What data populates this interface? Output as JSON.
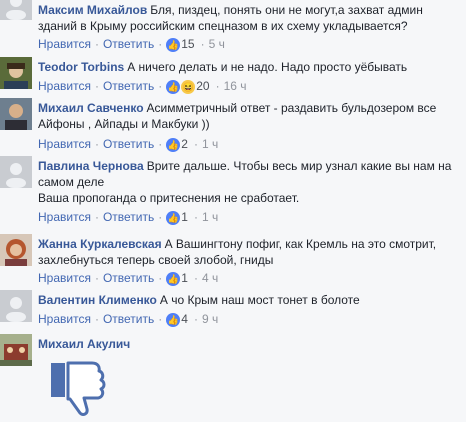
{
  "comments": [
    {
      "author": "Максим Михайлов",
      "text": "Бля, пиздец, понять они не могут,а захват админ зданий в Крыму российским спецназом в их схему укладывается?",
      "like_label": "Нравится",
      "reply_label": "Ответить",
      "reaction_count": "15",
      "time": "5 ч",
      "reactions": [
        "like"
      ]
    },
    {
      "author": "Teodor Torbins",
      "text": "А ничего делать и не надо. Надо просто уёбывать",
      "like_label": "Нравится",
      "reply_label": "Ответить",
      "reaction_count": "20",
      "time": "16 ч",
      "reactions": [
        "like",
        "haha"
      ]
    },
    {
      "author": "Михаил Савченко",
      "text": "Асимметричный ответ - раздавить бульдозером все Айфоны , Айпады и Макбуки ))",
      "like_label": "Нравится",
      "reply_label": "Ответить",
      "reaction_count": "2",
      "time": "1 ч",
      "reactions": [
        "like"
      ]
    },
    {
      "author": "Павлина Чернова",
      "text": "Врите дальше. Чтобы весь мир узнал какие вы нам на самом деле",
      "text2": "Ваша пропоганда о притеснения не сработает.",
      "like_label": "Нравится",
      "reply_label": "Ответить",
      "reaction_count": "1",
      "time": "1 ч",
      "reactions": [
        "like"
      ]
    },
    {
      "author": "Жанна Куркалевская",
      "text": "А Вашингтону пофиг, как Кремль на это смотрит, захлебнуться теперь своей злобой, гниды",
      "like_label": "Нравится",
      "reply_label": "Ответить",
      "reaction_count": "1",
      "time": "4 ч",
      "reactions": [
        "like"
      ]
    },
    {
      "author": "Валентин Клименко",
      "text": "А чо Крым наш мост тонет в болоте",
      "like_label": "Нравится",
      "reply_label": "Ответить",
      "reaction_count": "4",
      "time": "9 ч",
      "reactions": [
        "like"
      ]
    },
    {
      "author": "Михаил Акулич",
      "text": ""
    }
  ],
  "colors": {
    "link": "#385898",
    "meta": "#90949c",
    "like": "#4f7ff7",
    "thumbs_down": "#4e6fae"
  },
  "icons": {
    "reaction_like": "thumbs-up-icon",
    "reaction_haha": "haha-icon",
    "big_thumbs_down": "thumbs-down-icon"
  }
}
